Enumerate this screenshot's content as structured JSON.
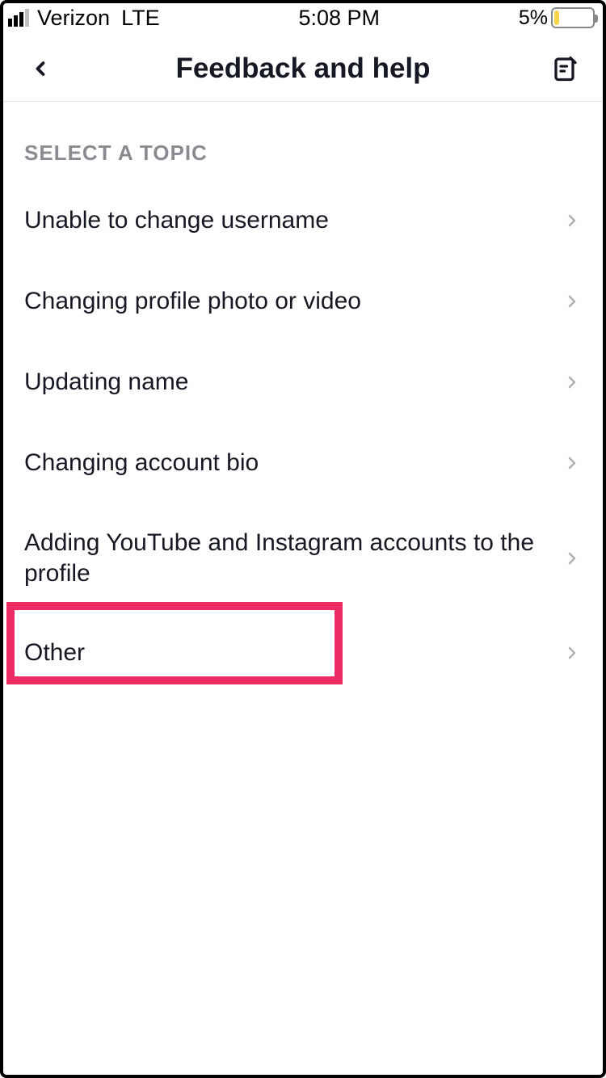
{
  "status": {
    "carrier": "Verizon",
    "network": "LTE",
    "time": "5:08 PM",
    "battery_pct": "5%"
  },
  "nav": {
    "title": "Feedback and help"
  },
  "section_header": "SELECT A TOPIC",
  "topics": [
    {
      "label": "Unable to change username"
    },
    {
      "label": "Changing profile photo or video"
    },
    {
      "label": "Updating name"
    },
    {
      "label": "Changing account bio"
    },
    {
      "label": "Adding YouTube and Instagram accounts to the profile"
    },
    {
      "label": "Other"
    }
  ],
  "highlight": {
    "index": 5,
    "color": "#ed2a63"
  }
}
